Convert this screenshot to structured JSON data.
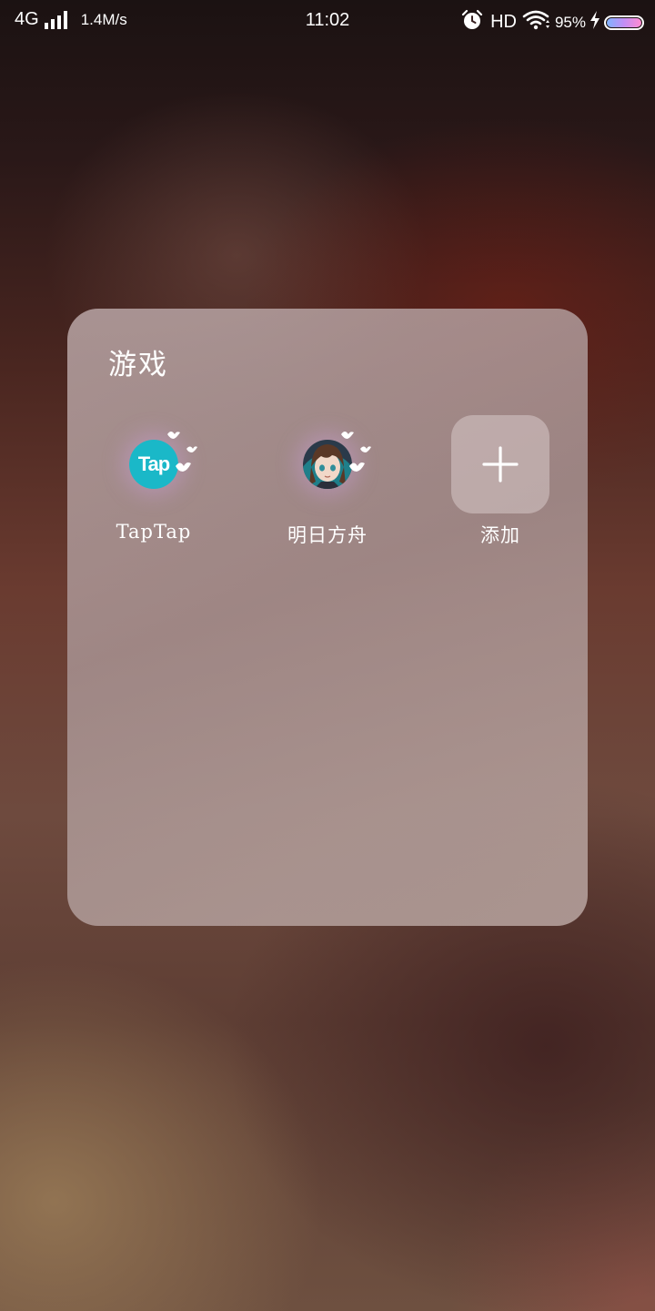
{
  "status_bar": {
    "network": "4G",
    "speed": "1.4M/s",
    "time": "11:02",
    "hd": "HD",
    "battery_percent": "95%",
    "icons": [
      "signal-icon",
      "alarm-icon",
      "wifi-icon",
      "charging-bolt-icon",
      "battery-icon"
    ]
  },
  "folder": {
    "title": "游戏",
    "apps": [
      {
        "label": "TapTap",
        "icon": "taptap-icon",
        "icon_text": "Tap",
        "color": "#1ab8c8"
      },
      {
        "label": "明日方舟",
        "icon": "arknights-icon"
      },
      {
        "label": "添加",
        "icon": "plus-icon"
      }
    ]
  }
}
